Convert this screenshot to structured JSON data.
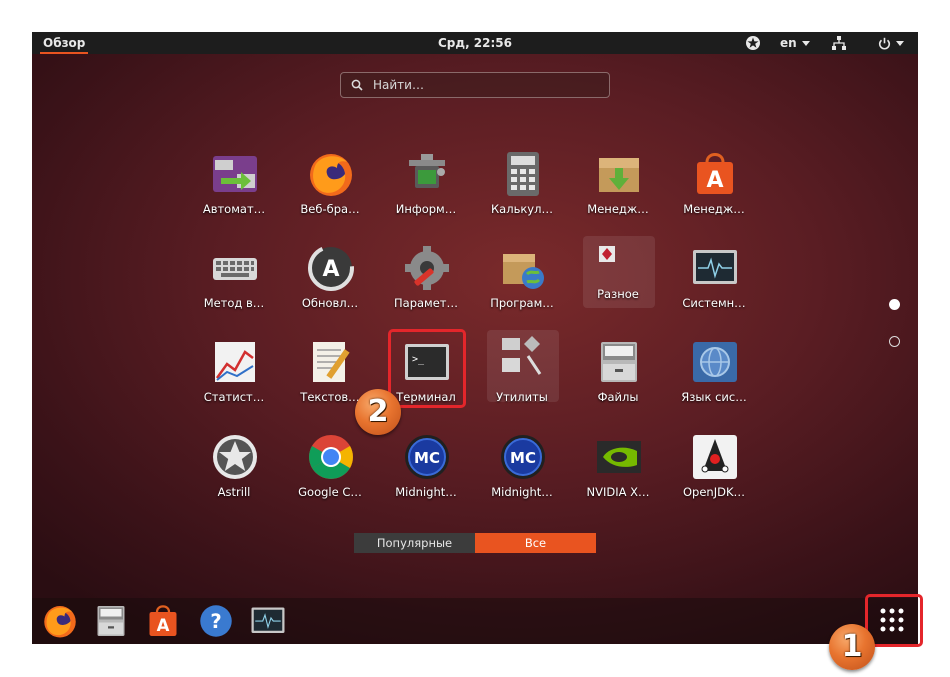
{
  "topbar": {
    "activities": "Обзор",
    "clock": "Срд, 22:56",
    "language": "en"
  },
  "search": {
    "placeholder": "Найти…"
  },
  "apps": {
    "r1": [
      "Автомат…",
      "Веб-бра…",
      "Информ…",
      "Калькул…",
      "Менедж…",
      "Менедж…"
    ],
    "r2": [
      "Метод в…",
      "Обновл…",
      "Парамет…",
      "Програм…",
      "Разное",
      "Системн…"
    ],
    "r3": [
      "Статист…",
      "Текстов…",
      "Терминал",
      "Утилиты",
      "Файлы",
      "Язык сис…"
    ],
    "r4": [
      "Astrill",
      "Google C…",
      "Midnight…",
      "Midnight…",
      "NVIDIA X…",
      "OpenJDK…"
    ]
  },
  "tabs": {
    "popular": "Популярные",
    "all": "Все"
  },
  "annotations": {
    "step1": "1",
    "step2": "2"
  },
  "colors": {
    "accent": "#e95420",
    "highlight": "#e4262b",
    "topbar": "#1d1d1d"
  }
}
